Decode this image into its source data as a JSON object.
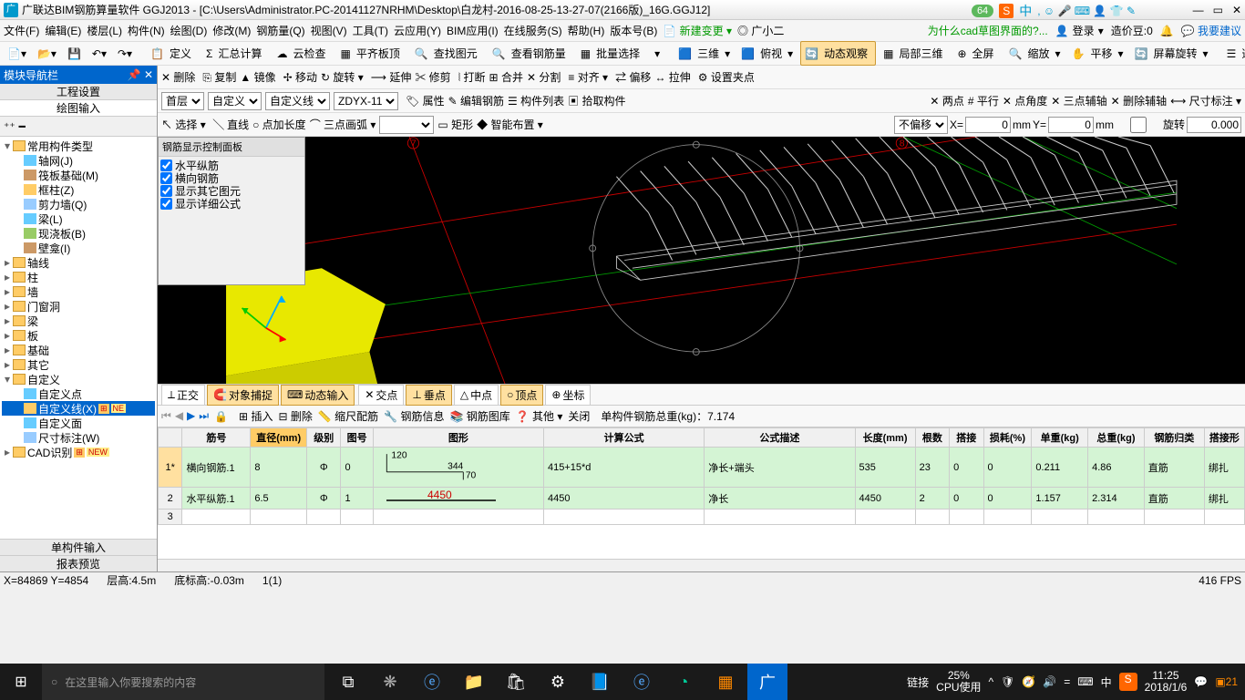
{
  "title": "广联达BIM钢筋算量软件 GGJ2013 - [C:\\Users\\Administrator.PC-20141127NRHM\\Desktop\\白龙村-2016-08-25-13-27-07(2166版)_16G.GGJ12]",
  "topicons": {
    "g64": "64",
    "ime": "中",
    "sogou": "S"
  },
  "menu": {
    "items": [
      "文件(F)",
      "编辑(E)",
      "楼层(L)",
      "构件(N)",
      "绘图(D)",
      "修改(M)",
      "钢筋量(Q)",
      "视图(V)",
      "工具(T)",
      "云应用(Y)",
      "BIM应用(I)",
      "在线服务(S)",
      "帮助(H)",
      "版本号(B)"
    ],
    "newchange": "新建变更",
    "assistant": "广小二",
    "question": "为什么cad草图界面的?...",
    "login": "登录",
    "credits_label": "造价豆:",
    "credits": "0",
    "suggest": "我要建议"
  },
  "tb1": {
    "define": "定义",
    "sum": "汇总计算",
    "cloud": "云检查",
    "flat": "平齐板顶",
    "findimg": "查找图元",
    "viewrebar": "查看钢筋量",
    "batch": "批量选择",
    "v3d": "三维",
    "top": "俯视",
    "dynobs": "动态观察",
    "local3d": "局部三维",
    "full": "全屏",
    "zoom": "缩放",
    "pan": "平移",
    "rotate": "屏幕旋转",
    "selfloor": "选择楼层"
  },
  "tb2": {
    "del": "删除",
    "copy": "复制",
    "mirror": "镜像",
    "move": "移动",
    "rot": "旋转",
    "extend": "延伸",
    "trim": "修剪",
    "break": "打断",
    "merge": "合并",
    "split": "分割",
    "align": "对齐",
    "offset": "偏移",
    "stretch": "拉伸",
    "fixpt": "设置夹点"
  },
  "tb3": {
    "floor": "首层",
    "custom": "自定义",
    "customline": "自定义线",
    "zdyx": "ZDYX-11",
    "prop": "属性",
    "editrebar": "编辑钢筋",
    "complist": "构件列表",
    "pick": "拾取构件",
    "twopt": "两点",
    "parallel": "平行",
    "ptang": "点角度",
    "threept": "三点辅轴",
    "delaxis": "删除辅轴",
    "dim": "尺寸标注"
  },
  "tb4": {
    "select": "选择",
    "line": "直线",
    "ptlen": "点加长度",
    "arc3": "三点画弧",
    "rect": "矩形",
    "smart": "智能布置",
    "nooffset": "不偏移",
    "x_label": "X=",
    "x_val": "0",
    "x_unit": "mm",
    "y_label": "Y=",
    "y_val": "0",
    "y_unit": "mm",
    "rot_label": "旋转",
    "rot_val": "0.000"
  },
  "sidebar": {
    "header": "模块导航栏",
    "tab1": "工程设置",
    "tab2": "绘图输入",
    "tree": {
      "root": "常用构件类型",
      "axisnet": "轴网(J)",
      "raft": "筏板基础(M)",
      "framecol": "框柱(Z)",
      "shearwall": "剪力墙(Q)",
      "beam": "梁(L)",
      "castslab": "现浇板(B)",
      "niche": "壁龛(I)",
      "axis": "轴线",
      "col": "柱",
      "wall": "墙",
      "opening": "门窗洞",
      "beam2": "梁",
      "slab": "板",
      "found": "基础",
      "other": "其它",
      "custom": "自定义",
      "custompt": "自定义点",
      "customline": "自定义线(X)",
      "customface": "自定义面",
      "dimnote": "尺寸标注(W)",
      "cad": "CAD识别"
    },
    "bottom1": "单构件输入",
    "bottom2": "报表预览"
  },
  "ctrlpanel": {
    "title": "钢筋显示控制面板",
    "opt1": "水平纵筋",
    "opt2": "横向钢筋",
    "opt3": "显示其它图元",
    "opt4": "显示详细公式"
  },
  "snap": {
    "ortho": "正交",
    "osnap": "对象捕捉",
    "dyninput": "动态输入",
    "inter": "交点",
    "perp": "垂点",
    "mid": "中点",
    "vertex": "顶点",
    "coord": "坐标"
  },
  "rebarbar": {
    "insert": "插入",
    "delete": "删除",
    "scale": "缩尺配筋",
    "info": "钢筋信息",
    "lib": "钢筋图库",
    "other": "其他",
    "close": "关闭",
    "total_label": "单构件钢筋总重(kg)：",
    "total": "7.174"
  },
  "table": {
    "headers": [
      "",
      "筋号",
      "直径(mm)",
      "级别",
      "图号",
      "图形",
      "计算公式",
      "公式描述",
      "长度(mm)",
      "根数",
      "搭接",
      "损耗(%)",
      "单重(kg)",
      "总重(kg)",
      "钢筋归类",
      "搭接形"
    ],
    "rows": [
      {
        "n": "1*",
        "name": "横向钢筋.1",
        "dia": "8",
        "grade": "Φ",
        "fig": "0",
        "shape": {
          "a": "120",
          "b": "344",
          "c": "70"
        },
        "formula": "415+15*d",
        "desc": "净长+端头",
        "len": "535",
        "count": "23",
        "lap": "0",
        "loss": "0",
        "unit": "0.211",
        "total": "4.86",
        "class": "直筋",
        "joint": "绑扎"
      },
      {
        "n": "2",
        "name": "水平纵筋.1",
        "dia": "6.5",
        "grade": "Φ",
        "fig": "1",
        "shape_line": "4450",
        "formula": "4450",
        "desc": "净长",
        "len": "4450",
        "count": "2",
        "lap": "0",
        "loss": "0",
        "unit": "1.157",
        "total": "2.314",
        "class": "直筋",
        "joint": "绑扎"
      },
      {
        "n": "3"
      }
    ]
  },
  "status": {
    "coords": "X=84869 Y=4854",
    "floor": "层高:4.5m",
    "base": "底标高:-0.03m",
    "sel": "1(1)",
    "fps": "416 FPS"
  },
  "taskbar": {
    "search_placeholder": "在这里输入你要搜索的内容",
    "link": "链接",
    "cpu_pct": "25%",
    "cpu_lbl": "CPU使用",
    "ime": "中",
    "time": "11:25",
    "date": "2018/1/6"
  },
  "axis": {
    "a7": "7",
    "a8": "8"
  }
}
